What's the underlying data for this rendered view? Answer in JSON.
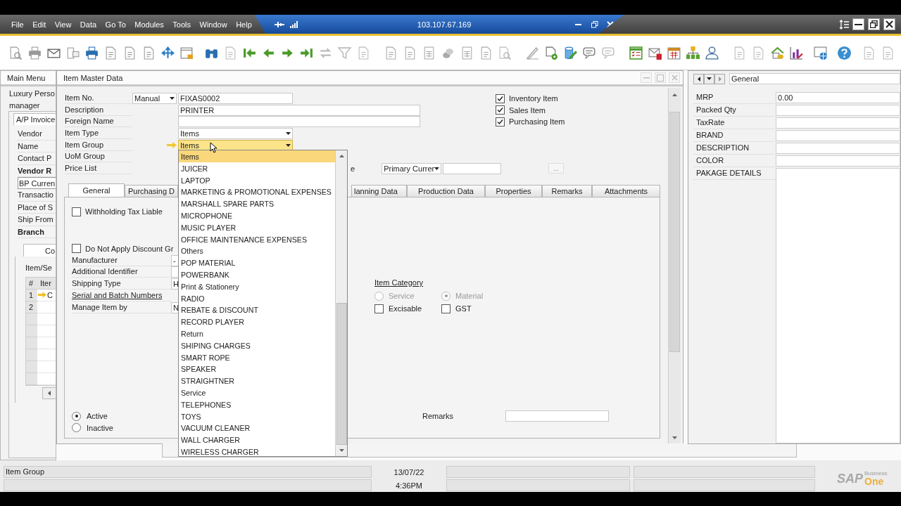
{
  "menu_bar": {
    "items": [
      "File",
      "Edit",
      "View",
      "Data",
      "Go To",
      "Modules",
      "Tools",
      "Window",
      "Help"
    ]
  },
  "remote_bar": {
    "address": "103.107.67.169"
  },
  "main_menu": {
    "title": "Main Menu",
    "company": "Luxury Perso",
    "user": "manager"
  },
  "ap_invoice": {
    "tab": "A/P Invoice",
    "fields": [
      {
        "label": "Vendor",
        "kind": "plain"
      },
      {
        "label": "Name",
        "kind": "plain"
      },
      {
        "label": "Contact P",
        "kind": "plain"
      },
      {
        "label": "Vendor R",
        "kind": "bold"
      },
      {
        "label": "BP Curren",
        "kind": "select"
      },
      {
        "label": "Transactio",
        "kind": "plain"
      },
      {
        "label": "Place of S",
        "kind": "plain"
      },
      {
        "label": "Ship From",
        "kind": "plain"
      },
      {
        "label": "Branch",
        "kind": "bold"
      }
    ],
    "inner_tab": "Co",
    "table_title": "Item/Se",
    "columns": [
      "#",
      "Iter"
    ],
    "rows": [
      {
        "num": "1",
        "cell": "C",
        "current": true
      },
      {
        "num": "2",
        "current": false
      }
    ]
  },
  "item_master": {
    "title": "Item Master Data",
    "header_fields": [
      {
        "label": "Item No.",
        "kind": "series",
        "series": "Manual",
        "value": "FIXAS0002"
      },
      {
        "label": "Description",
        "kind": "wide",
        "value": "PRINTER"
      },
      {
        "label": "Foreign Name",
        "kind": "wide"
      },
      {
        "label": "Item Type",
        "kind": "select",
        "value": "Items",
        "focused": false
      },
      {
        "label": "Item Group",
        "kind": "select",
        "value": "Items",
        "focused": true
      },
      {
        "label": "UoM Group",
        "kind": "label"
      },
      {
        "label": "Price List",
        "kind": "label"
      }
    ],
    "price_label_tail": "e",
    "currency": "Primary Currer",
    "more_button": "...",
    "flags": [
      {
        "label": "Inventory Item",
        "checked": true
      },
      {
        "label": "Sales Item",
        "checked": true
      },
      {
        "label": "Purchasing Item",
        "checked": true
      }
    ],
    "tabs": [
      {
        "label": "General",
        "selected": true
      },
      {
        "label": "Purchasing D",
        "selected": false
      },
      {
        "label": "lanning Data",
        "selected": false
      },
      {
        "label": "Production Data",
        "selected": false
      },
      {
        "label": "Properties",
        "selected": false
      },
      {
        "label": "Remarks",
        "selected": false
      },
      {
        "label": "Attachments",
        "selected": false
      }
    ],
    "general": {
      "withholding": {
        "label": "Withholding Tax Liable",
        "checked": false
      },
      "no_discount": {
        "label": "Do Not Apply Discount Gr",
        "checked": false
      },
      "fields": [
        {
          "label": "Manufacturer",
          "kind": "field",
          "value": "-"
        },
        {
          "label": "Additional Identifier",
          "kind": "field"
        },
        {
          "label": "Shipping Type",
          "kind": "field",
          "value": "H"
        },
        {
          "label": "Serial and Batch Numbers",
          "kind": "link"
        },
        {
          "label": "Manage Item by",
          "kind": "field",
          "value": "N"
        }
      ],
      "category": {
        "title": "Item Category",
        "disabled": true,
        "options": [
          {
            "label": "Service",
            "selected": false
          },
          {
            "label": "Material",
            "selected": true
          }
        ]
      },
      "category_checks": [
        {
          "label": "Excisable",
          "checked": false
        },
        {
          "label": "GST",
          "checked": false
        }
      ],
      "status": [
        {
          "label": "Active",
          "selected": true
        },
        {
          "label": "Inactive",
          "selected": false
        }
      ],
      "remarks_label": "Remarks"
    }
  },
  "dropdown": {
    "items": [
      {
        "label": "Items",
        "selected": true
      },
      {
        "label": "JUICER",
        "selected": false
      },
      {
        "label": "LAPTOP",
        "selected": false
      },
      {
        "label": "MARKETING & PROMOTIONAL EXPENSES",
        "selected": false
      },
      {
        "label": "MARSHALL SPARE PARTS",
        "selected": false
      },
      {
        "label": "MICROPHONE",
        "selected": false
      },
      {
        "label": "MUSIC PLAYER",
        "selected": false
      },
      {
        "label": "OFFICE MAINTENANCE EXPENSES",
        "selected": false
      },
      {
        "label": "Others",
        "selected": false
      },
      {
        "label": "POP MATERIAL",
        "selected": false
      },
      {
        "label": "POWERBANK",
        "selected": false
      },
      {
        "label": "Print & Stationery",
        "selected": false
      },
      {
        "label": "RADIO",
        "selected": false
      },
      {
        "label": "REBATE & DISCOUNT",
        "selected": false
      },
      {
        "label": "RECORD PLAYER",
        "selected": false
      },
      {
        "label": "Return",
        "selected": false
      },
      {
        "label": "SHIPING CHARGES",
        "selected": false
      },
      {
        "label": "SMART ROPE",
        "selected": false
      },
      {
        "label": "SPEAKER",
        "selected": false
      },
      {
        "label": "STRAIGHTNER",
        "selected": false
      },
      {
        "label": "Service",
        "selected": false
      },
      {
        "label": "TELEPHONES",
        "selected": false
      },
      {
        "label": "TOYS",
        "selected": false
      },
      {
        "label": "VACUUM CLEANER",
        "selected": false
      },
      {
        "label": "WALL CHARGER",
        "selected": false
      },
      {
        "label": "WIRELESS CHARGER",
        "selected": false
      }
    ]
  },
  "udf_panel": {
    "category": "General",
    "fields": [
      {
        "label": "MRP",
        "kind": "line",
        "value": "0.00"
      },
      {
        "label": "Packed Qty",
        "kind": "line"
      },
      {
        "label": "TaxRate",
        "kind": "line"
      },
      {
        "label": "BRAND",
        "kind": "line"
      },
      {
        "label": "DESCRIPTION",
        "kind": "line"
      },
      {
        "label": "COLOR",
        "kind": "line"
      },
      {
        "label": "PAKAGE DETAILS",
        "kind": "memo"
      }
    ]
  },
  "status_bar": {
    "message": "Item Group",
    "date": "13/07/22",
    "time": "4:36PM"
  },
  "logo": {
    "brand": "SAP",
    "line1": "Business",
    "line2": "One"
  }
}
